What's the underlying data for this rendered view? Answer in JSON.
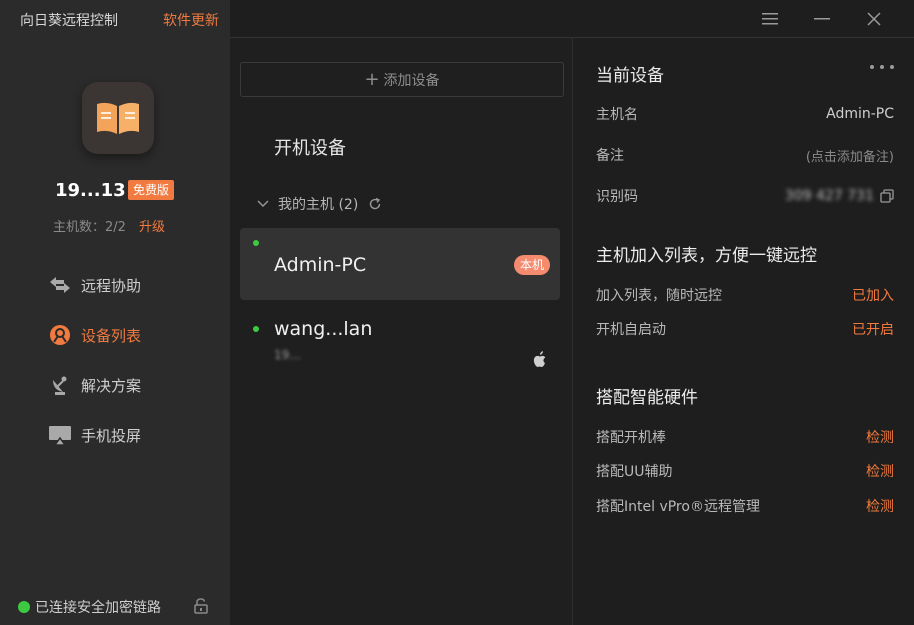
{
  "sidebar": {
    "app_title": "向日葵远程控制",
    "update_link": "软件更新",
    "user_id": "19...13",
    "plan_badge": "免费版",
    "host_count": "主机数：2/2",
    "upgrade_link": "升级",
    "nav": [
      {
        "label": "远程协助",
        "icon": "remote-assist-icon",
        "active": false
      },
      {
        "label": "设备列表",
        "icon": "device-list-icon",
        "active": true
      },
      {
        "label": "解决方案",
        "icon": "satellite-icon",
        "active": false
      },
      {
        "label": "手机投屏",
        "icon": "screen-cast-icon",
        "active": false
      }
    ],
    "status_text": "已连接安全加密链路",
    "colors": {
      "accent": "#f07a3f",
      "online": "#3ec943",
      "sidebar_bg": "#2b2b2b"
    }
  },
  "device_list": {
    "add_device_label": "添加设备",
    "section_title": "开机设备",
    "group_label": "我的主机 (2)",
    "devices": [
      {
        "name": "Admin-PC",
        "sub": "",
        "badge": "本机",
        "online": true,
        "os_icon": ""
      },
      {
        "name": "wang...lan",
        "sub": "19...",
        "badge": "",
        "online": true,
        "os_icon": "apple-icon"
      }
    ]
  },
  "current_device": {
    "title": "当前设备",
    "hostname_key": "主机名",
    "hostname_val": "Admin-PC",
    "note_key": "备注",
    "note_val": "(点击添加备注)",
    "id_key": "识别码",
    "id_val": "309 427 731"
  },
  "host_join": {
    "title": "主机加入列表，方便一键远控",
    "rows": [
      {
        "key": "加入列表，随时远控",
        "val": "已加入"
      },
      {
        "key": "开机自启动",
        "val": "已开启"
      }
    ]
  },
  "hardware": {
    "title": "搭配智能硬件",
    "rows": [
      {
        "key": "搭配开机棒",
        "val": "检测"
      },
      {
        "key": "搭配UU辅助",
        "val": "检测"
      },
      {
        "key": "搭配Intel vPro®远程管理",
        "val": "检测"
      }
    ]
  }
}
